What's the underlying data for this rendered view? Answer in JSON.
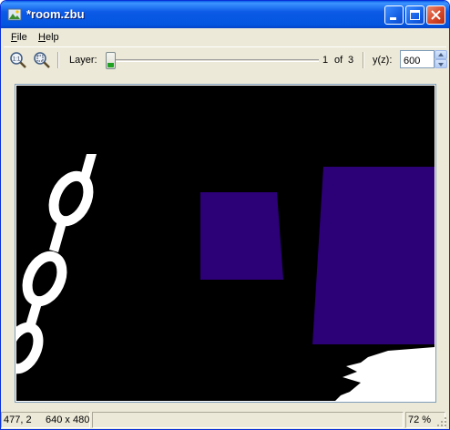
{
  "window": {
    "title": "*room.zbu"
  },
  "menu": [
    {
      "accel": "F",
      "rest": "ile"
    },
    {
      "accel": "H",
      "rest": "elp"
    }
  ],
  "toolbar": {
    "zoom_actual_icon": "zoom-actual-size-icon",
    "zoom_fit_icon": "zoom-fit-icon",
    "layer_label": "Layer:",
    "layer_current": "1",
    "layer_of": "of",
    "layer_total": "3",
    "layer_position": 0.0,
    "yz_label": "y(z):",
    "yz_value": "600"
  },
  "status": {
    "coords": "477, 2",
    "dimensions": "640 x 480",
    "zoom": "72 %"
  },
  "colors": {
    "title_bar": "#0355e0",
    "canvas_background": "#000000",
    "shape_fill": "#2c0077",
    "foreground_white": "#ffffff"
  }
}
